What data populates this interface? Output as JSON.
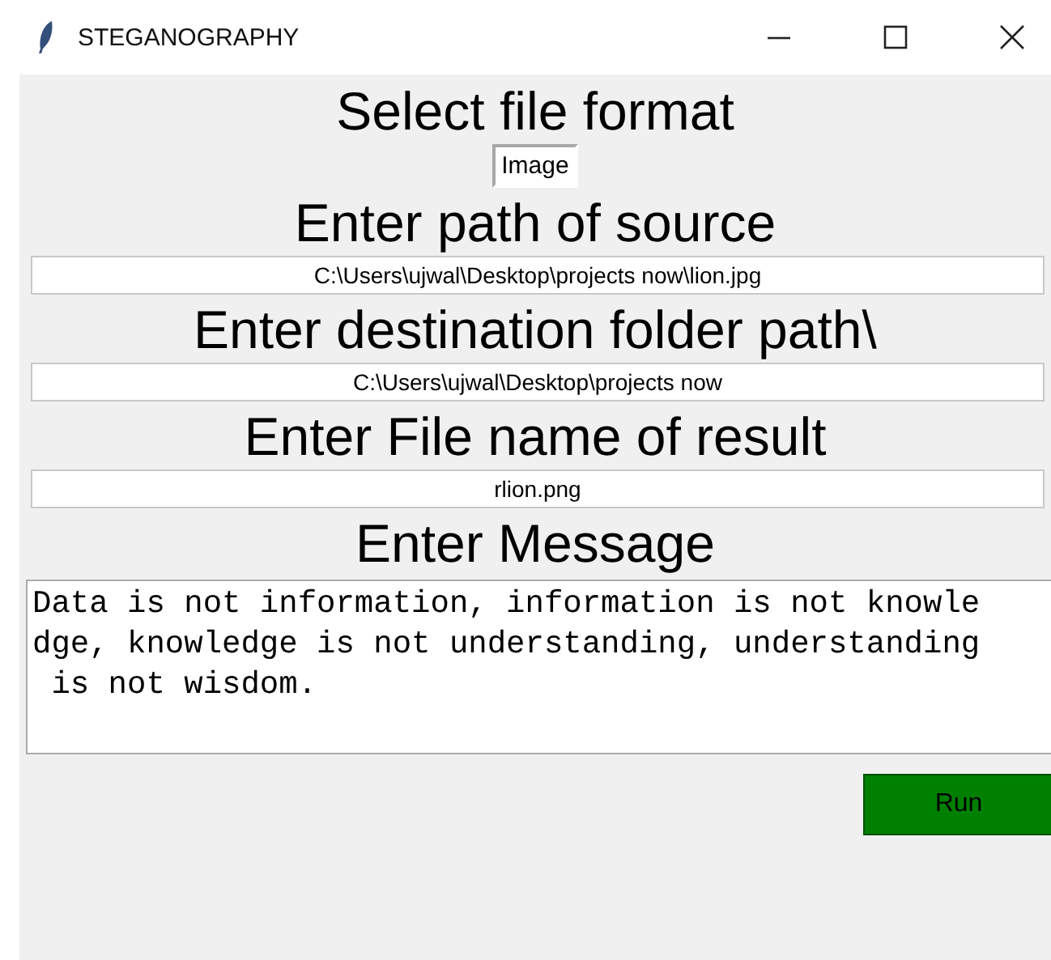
{
  "window": {
    "title": "STEGANOGRAPHY"
  },
  "sections": [
    {
      "kind": "dropdown",
      "label": "Select file format",
      "value": "Image"
    },
    {
      "kind": "entry",
      "label": "Enter path of source",
      "value": "C:\\Users\\ujwal\\Desktop\\projects now\\lion.jpg"
    },
    {
      "kind": "entry",
      "label": "Enter destination folder path\\",
      "value": "C:\\Users\\ujwal\\Desktop\\projects now"
    },
    {
      "kind": "entry",
      "label": "Enter File name of result",
      "value": "rlion.png"
    },
    {
      "kind": "text",
      "label": "Enter Message",
      "lines": [
        "Data is not information, information is not knowle",
        "dge, knowledge is not understanding, understanding",
        " is not wisdom."
      ]
    }
  ],
  "run_button": "Run"
}
